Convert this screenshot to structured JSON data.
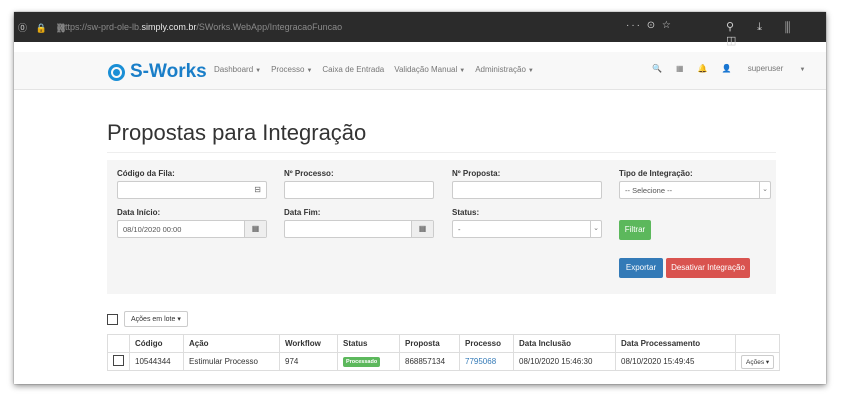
{
  "browser": {
    "url_prefix": "https://sw-prd-ole-lb.",
    "url_domain": "simply.com.br",
    "url_path": "/SWorks.WebApp/IntegracaoFuncao",
    "dots": "··· ⊙ ☆",
    "right_icons": "⚲ ⤓ ⫼ ◫",
    "left_icons": "⓪ 🔒 ⛓"
  },
  "navbar": {
    "brand": "S-Works",
    "items": [
      {
        "label": "Dashboard",
        "dropdown": true
      },
      {
        "label": "Processo",
        "dropdown": true
      },
      {
        "label": "Caixa de Entrada",
        "dropdown": false
      },
      {
        "label": "Validação Manual",
        "dropdown": true
      },
      {
        "label": "Administração",
        "dropdown": true
      }
    ],
    "caret": "▼",
    "search_icon": "🔍",
    "calendar_icon": "▦",
    "bell_icon": "🔔",
    "user_icon": "👤",
    "user": "superuser"
  },
  "page": {
    "title": "Propostas para Integração"
  },
  "filters": {
    "codigo_fila": {
      "label": "Código da Fila:",
      "value": ""
    },
    "n_processo": {
      "label": "Nº Processo:",
      "value": ""
    },
    "n_proposta": {
      "label": "Nº Proposta:",
      "value": ""
    },
    "tipo_integracao": {
      "label": "Tipo de Integração:",
      "value": "-- Selecione --"
    },
    "data_inicio": {
      "label": "Data Início:",
      "value": "08/10/2020 00:00"
    },
    "data_fim": {
      "label": "Data Fim:",
      "value": ""
    },
    "status": {
      "label": "Status:",
      "value": "-"
    },
    "filtrar": "Filtrar",
    "exportar": "Exportar",
    "desativar": "Desativar Integração"
  },
  "batch": {
    "label": "Ações em lote",
    "caret": "▾"
  },
  "table": {
    "headers": [
      "Código",
      "Ação",
      "Workflow",
      "Status",
      "Proposta",
      "Processo",
      "Data Inclusão",
      "Data Processamento"
    ],
    "rows": [
      {
        "codigo": "10544344",
        "acao": "Estimular Processo",
        "workflow": "974",
        "status": "Processado",
        "proposta": "868857134",
        "processo": "7795068",
        "data_inclusao": "08/10/2020 15:46:30",
        "data_processamento": "08/10/2020 15:49:45",
        "acoes": "Ações ▾"
      }
    ]
  }
}
